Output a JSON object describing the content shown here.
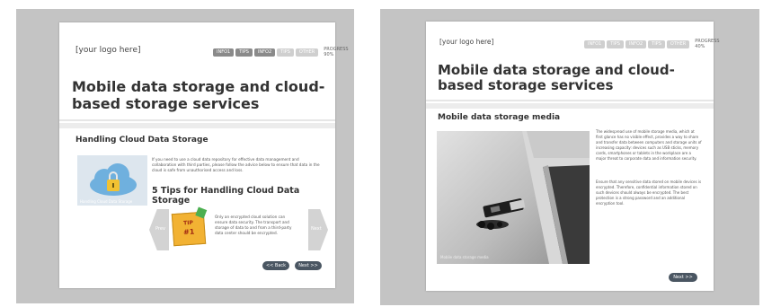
{
  "left": {
    "logo": "[your logo here]",
    "tabs": [
      "INFO1",
      "TIPS",
      "INFO2",
      "TIPS",
      "OTHER"
    ],
    "progress": "PROGRESS 90%",
    "title": "Mobile data storage and cloud-based storage services",
    "section_heading": "Handling Cloud Data Storage",
    "intro_text": "If you need to use a cloud data repository for effective data management and collaboration with third parties, please follow the advice below to ensure that data in the cloud is safe from unauthorised access and loss.",
    "image_caption": "Handling Cloud Data Storage",
    "tips_heading": "5 Tips for Handling Cloud Data Storage",
    "tip_badge": {
      "line1": "TIP",
      "line2": "#1"
    },
    "tip_text": "Only an encrypted cloud solution can ensure data security. The transport and storage of data to and from a third-party data center should be encrypted.",
    "prev_arrow": "Prev",
    "next_arrow": "Next",
    "back_button": "<< Back",
    "next_button": "Next >>"
  },
  "right": {
    "logo": "[your logo here]",
    "tabs": [
      "INFO1",
      "TIPS",
      "INFO2",
      "TIPS",
      "OTHER"
    ],
    "progress": "PROGRESS 40%",
    "title": "Mobile data storage and cloud-based storage services",
    "section_heading": "Mobile data storage media",
    "para1": "The widespread use of mobile storage media, which at first glance has no visible effect, provides a way to share and transfer data between computers and storage units of increasing capacity: devices such as USB sticks, memory cards, smartphones or tablets in the workplace are a major threat to corporate data and information security.",
    "para2": "Ensure that any sensitive data stored on mobile devices is encrypted. Therefore, confidential information stored on such devices should always be encrypted. The best protection is a strong password and an additional encryption tool.",
    "image_caption": "Mobile data storage media",
    "next_button": "Next >>"
  },
  "colors": {
    "panel_bg": "#c4c4c4",
    "button_bg": "#4a5662",
    "tab_bg": "#8a8a8a",
    "tip_badge": "#f2b233"
  }
}
